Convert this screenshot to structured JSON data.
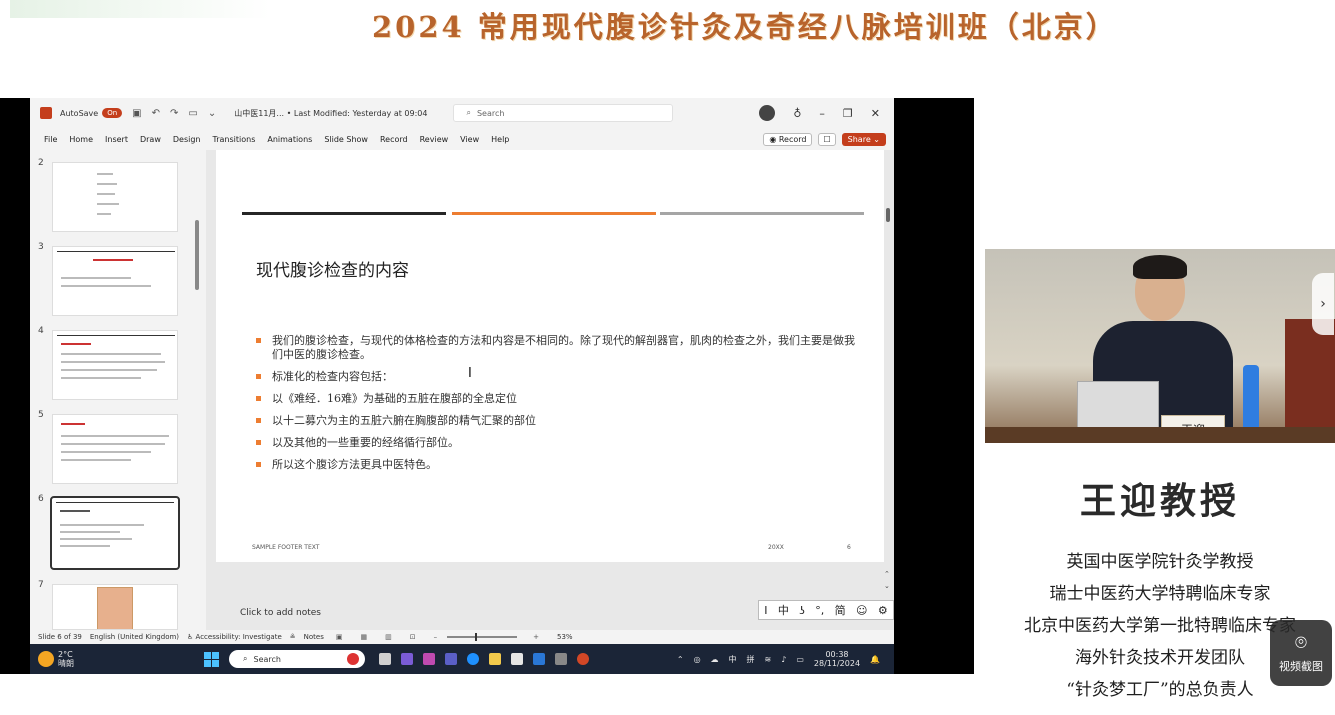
{
  "banner": {
    "title": "2024 常用现代腹诊针灸及奇经八脉培训班（北京）"
  },
  "titlebar": {
    "autosave": "AutoSave",
    "autosave_state": "On",
    "filename": "山中医11月... • Last Modified: Yesterday at 09:04",
    "search_placeholder": "Search"
  },
  "ribbon": {
    "tabs": [
      "File",
      "Home",
      "Insert",
      "Draw",
      "Design",
      "Transitions",
      "Animations",
      "Slide Show",
      "Record",
      "Review",
      "View",
      "Help"
    ],
    "record": "Record",
    "share": "Share"
  },
  "thumbnails": {
    "numbers": [
      "2",
      "3",
      "4",
      "5",
      "6",
      "7"
    ],
    "selected": "6"
  },
  "slide": {
    "title": "现代腹诊检查的内容",
    "bullets": [
      "我们的腹诊检查，与现代的体格检查的方法和内容是不相同的。除了现代的解剖器官，肌肉的检查之外，我们主要是做我们中医的腹诊检查。",
      "标准化的检查内容包括：",
      "以《难经．16难》为基础的五脏在腹部的全息定位",
      "以十二募穴为主的五脏六腑在胸腹部的精气汇聚的部位",
      "以及其他的一些重要的经络循行部位。",
      "所以这个腹诊方法更具中医特色。"
    ],
    "footer": "SAMPLE FOOTER TEXT",
    "date": "20XX",
    "number": "6",
    "accent_colors": [
      "#262626",
      "#ed7d31",
      "#a5a5a5"
    ]
  },
  "notes_hint": "Click to add notes",
  "ime": [
    "I",
    "中",
    "ʖ",
    "°,",
    "简",
    "☺",
    "⚙"
  ],
  "statusbar": {
    "slide_info": "Slide 6 of 39",
    "language": "English (United Kingdom)",
    "accessibility": "Accessibility: Investigate",
    "notes": "Notes",
    "zoom": "53%"
  },
  "taskbar": {
    "temp": "2°C",
    "condition": "晴朗",
    "search": "Search",
    "lang1": "中",
    "lang2": "拼",
    "time": "00:38",
    "date": "28/11/2024"
  },
  "video": {
    "nameplate": "王迎"
  },
  "profile": {
    "name": "王迎教授",
    "titles": [
      "英国中医学院针灸学教授",
      "瑞士中医药大学特聘临床专家",
      "北京中医药大学第一批特聘临床专家",
      "海外针灸技术开发团队",
      "“针灸梦工厂”的总负责人"
    ]
  },
  "snapshot": {
    "label": "视频截图"
  }
}
